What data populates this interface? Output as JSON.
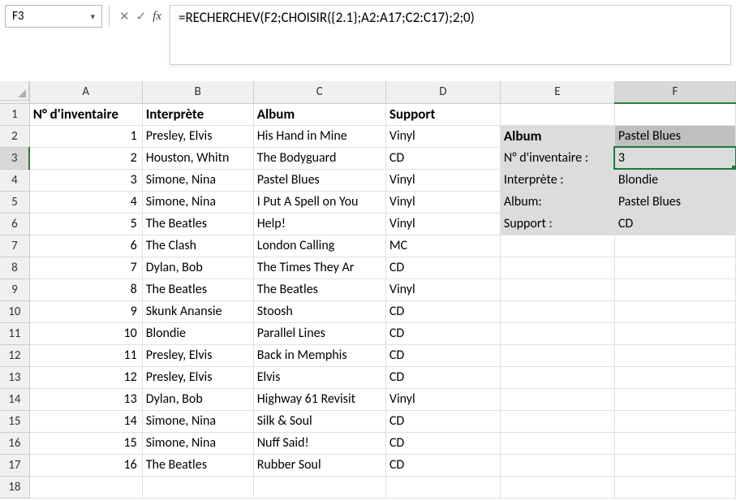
{
  "nameBox": "F3",
  "formula": "=RECHERCHEV(F2;CHOISIR({2.1};A2:A17;C2:C17);2;0)",
  "columns": [
    "A",
    "B",
    "C",
    "D",
    "E",
    "F"
  ],
  "selectedColumn": "F",
  "selectedRow": 3,
  "headers": {
    "A": "N° d'inventaire",
    "B": "Interprète",
    "C": "Album",
    "D": "Support"
  },
  "rows": [
    {
      "n": 1,
      "inv": "1",
      "int": "Presley, Elvis",
      "alb": "His Hand in Mine",
      "sup": "Vinyl"
    },
    {
      "n": 2,
      "inv": "2",
      "int": "Houston, Whitn",
      "alb": "The Bodyguard",
      "sup": "CD"
    },
    {
      "n": 3,
      "inv": "3",
      "int": "Simone, Nina",
      "alb": "Pastel Blues",
      "sup": "Vinyl"
    },
    {
      "n": 4,
      "inv": "4",
      "int": "Simone, Nina",
      "alb": "I Put A Spell on You",
      "sup": "Vinyl"
    },
    {
      "n": 5,
      "inv": "5",
      "int": "The Beatles",
      "alb": "Help!",
      "sup": "Vinyl"
    },
    {
      "n": 6,
      "inv": "6",
      "int": "The Clash",
      "alb": "London Calling",
      "sup": "MC"
    },
    {
      "n": 7,
      "inv": "7",
      "int": "Dylan, Bob",
      "alb": "The Times They Ar",
      "sup": "CD"
    },
    {
      "n": 8,
      "inv": "8",
      "int": "The Beatles",
      "alb": "The Beatles",
      "sup": "Vinyl"
    },
    {
      "n": 9,
      "inv": "9",
      "int": "Skunk Anansie",
      "alb": "Stoosh",
      "sup": "CD"
    },
    {
      "n": 10,
      "inv": "10",
      "int": "Blondie",
      "alb": "Parallel Lines",
      "sup": "CD"
    },
    {
      "n": 11,
      "inv": "11",
      "int": "Presley, Elvis",
      "alb": "Back in Memphis",
      "sup": "CD"
    },
    {
      "n": 12,
      "inv": "12",
      "int": "Presley, Elvis",
      "alb": "Elvis",
      "sup": "CD"
    },
    {
      "n": 13,
      "inv": "13",
      "int": "Dylan, Bob",
      "alb": "Highway 61 Revisit",
      "sup": "Vinyl"
    },
    {
      "n": 14,
      "inv": "14",
      "int": "Simone, Nina",
      "alb": "Silk & Soul",
      "sup": "CD"
    },
    {
      "n": 15,
      "inv": "15",
      "int": "Simone, Nina",
      "alb": "Nuff Said!",
      "sup": "CD"
    },
    {
      "n": 16,
      "inv": "16",
      "int": "The Beatles",
      "alb": "Rubber Soul",
      "sup": "CD"
    }
  ],
  "lookup": {
    "title_label": "Album",
    "title_value": "Pastel Blues",
    "inv_label": "N° d'inventaire :",
    "inv_value": "3",
    "int_label": "Interprète :",
    "int_value": "Blondie",
    "alb_label": "Album:",
    "alb_value": "Pastel Blues",
    "sup_label": "Support :",
    "sup_value": "CD"
  }
}
